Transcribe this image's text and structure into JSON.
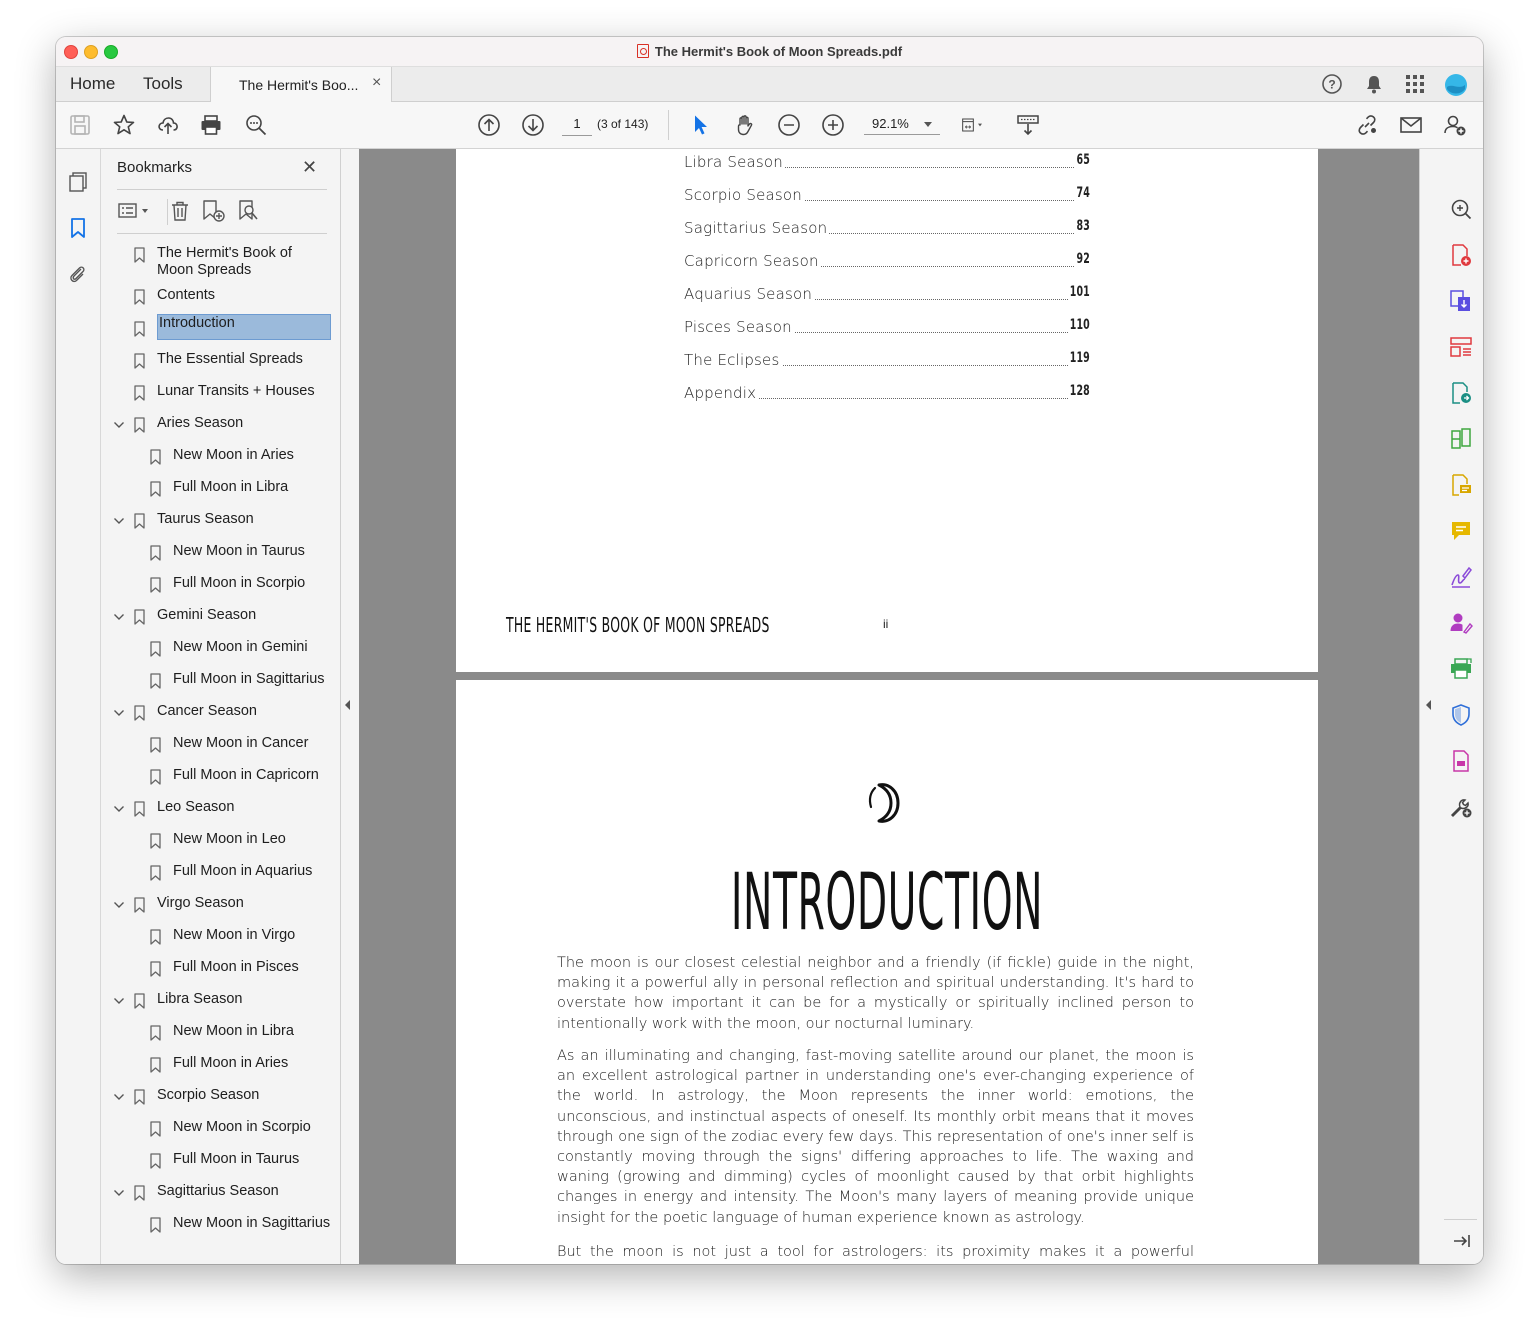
{
  "window": {
    "title": "The Hermit's Book of Moon Spreads.pdf"
  },
  "tabs": {
    "home": "Home",
    "tools": "Tools",
    "document": "The Hermit's Boo...",
    "close": "×"
  },
  "toolbar": {
    "page_number": "1",
    "page_count": "(3 of 143)",
    "zoom": "92.1%"
  },
  "bookmarks": {
    "title": "Bookmarks",
    "close": "✕",
    "items": [
      {
        "label": "The Hermit's Book of Moon Spreads",
        "level": 0
      },
      {
        "label": "Contents",
        "level": 0
      },
      {
        "label": "Introduction",
        "level": 0,
        "selected": true
      },
      {
        "label": "The Essential Spreads",
        "level": 0
      },
      {
        "label": "Lunar Transits + Houses",
        "level": 0
      },
      {
        "label": "Aries Season",
        "level": 0,
        "expanded": true
      },
      {
        "label": "New Moon in Aries",
        "level": 1
      },
      {
        "label": "Full Moon in Libra",
        "level": 1
      },
      {
        "label": "Taurus Season",
        "level": 0,
        "expanded": true
      },
      {
        "label": "New Moon in Taurus",
        "level": 1
      },
      {
        "label": "Full Moon in Scorpio",
        "level": 1
      },
      {
        "label": "Gemini Season",
        "level": 0,
        "expanded": true
      },
      {
        "label": "New Moon in Gemini",
        "level": 1
      },
      {
        "label": "Full Moon in Sagittarius",
        "level": 1
      },
      {
        "label": "Cancer Season",
        "level": 0,
        "expanded": true
      },
      {
        "label": "New Moon in Cancer",
        "level": 1
      },
      {
        "label": "Full Moon in Capricorn",
        "level": 1
      },
      {
        "label": "Leo Season",
        "level": 0,
        "expanded": true
      },
      {
        "label": "New Moon in Leo",
        "level": 1
      },
      {
        "label": "Full Moon in Aquarius",
        "level": 1
      },
      {
        "label": "Virgo Season",
        "level": 0,
        "expanded": true
      },
      {
        "label": "New Moon in Virgo",
        "level": 1
      },
      {
        "label": "Full Moon in Pisces",
        "level": 1
      },
      {
        "label": "Libra Season",
        "level": 0,
        "expanded": true
      },
      {
        "label": "New Moon in Libra",
        "level": 1
      },
      {
        "label": "Full Moon in Aries",
        "level": 1
      },
      {
        "label": "Scorpio Season",
        "level": 0,
        "expanded": true
      },
      {
        "label": "New Moon in Scorpio",
        "level": 1
      },
      {
        "label": "Full Moon in Taurus",
        "level": 1
      },
      {
        "label": "Sagittarius Season",
        "level": 0,
        "expanded": true
      },
      {
        "label": "New Moon in Sagittarius",
        "level": 1
      }
    ]
  },
  "document": {
    "toc": [
      {
        "name": "Libra Season",
        "page": "65"
      },
      {
        "name": "Scorpio Season",
        "page": "74"
      },
      {
        "name": "Sagittarius Season",
        "page": "83"
      },
      {
        "name": "Capricorn Season",
        "page": "92"
      },
      {
        "name": "Aquarius Season",
        "page": "101"
      },
      {
        "name": "Pisces Season",
        "page": "110"
      },
      {
        "name": "The Eclipses",
        "page": "119"
      },
      {
        "name": "Appendix",
        "page": "128"
      }
    ],
    "running_head": "THE HERMIT'S BOOK OF MOON SPREADS",
    "folio": "ii",
    "intro_title": "INTRODUCTION",
    "paragraphs": [
      "The moon is our closest celestial neighbor and a friendly (if fickle) guide in the night, making it a powerful ally in personal reflection and spiritual understanding. It's hard to overstate how important it can be for a mystically or spiritually inclined person to intentionally work with the moon, our nocturnal luminary.",
      "As an illuminating and changing, fast-moving satellite around our planet, the moon is an excellent astrological partner in understanding one's ever-changing experience of the world. In astrology, the Moon represents the inner world: emotions, the unconscious, and instinctual aspects of oneself. Its monthly orbit means that it moves through one sign of the zodiac every few days. This representation of one's inner self is constantly moving through the signs' differing approaches to life. The waxing and waning (growing and dimming) cycles of moonlight caused by that orbit highlights changes in energy and intensity. The Moon's many layers of meaning provide unique insight for the poetic language of human experience known as astrology.",
      "But the moon is not just a tool for astrologers: its proximity makes it a powerful magical"
    ]
  },
  "colors": {
    "selection": "#9bbadb",
    "accent_blue": "#1473e6",
    "page_bg": "#8a8a8a"
  }
}
